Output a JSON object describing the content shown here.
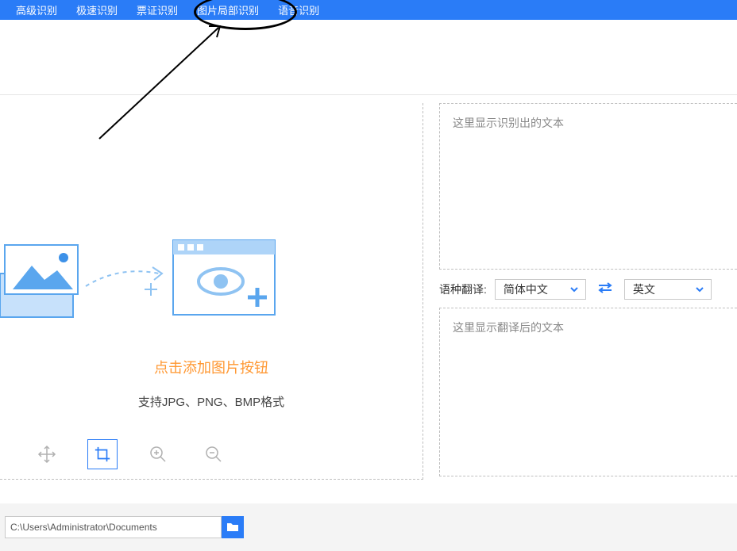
{
  "tabs": [
    "高级识别",
    "极速识别",
    "票证识别",
    "图片局部识别",
    "语音识别"
  ],
  "upload": {
    "title": "点击添加图片按钮",
    "subtitle": "支持JPG、PNG、BMP格式"
  },
  "recognized_placeholder": "这里显示识别出的文本",
  "translated_placeholder": "这里显示翻译后的文本",
  "translate": {
    "label": "语种翻译:",
    "source": "简体中文",
    "target": "英文"
  },
  "path": "C:\\Users\\Administrator\\Documents",
  "icons": {
    "move": "move-icon",
    "crop": "crop-icon",
    "zoom_in": "zoom-in-icon",
    "zoom_out": "zoom-out-icon",
    "folder": "folder-icon",
    "swap": "swap-icon"
  }
}
